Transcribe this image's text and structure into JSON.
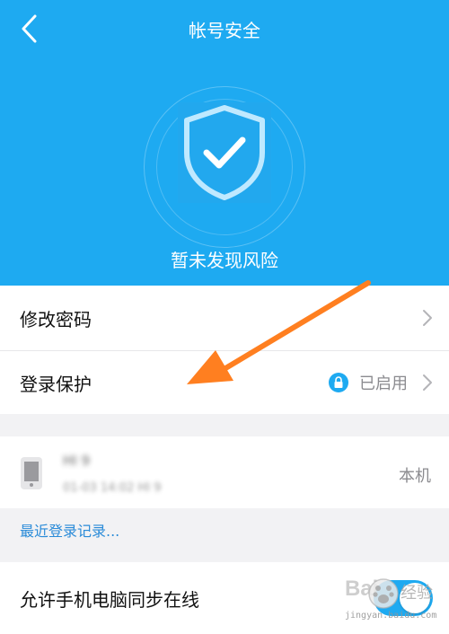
{
  "header": {
    "title": "帐号安全",
    "status_text": "暂未发现风险",
    "back_icon": "chevron-left-icon",
    "shield_icon": "shield-check-icon"
  },
  "menu": {
    "change_password": {
      "label": "修改密码"
    },
    "login_protection": {
      "label": "登录保护",
      "status": "已启用",
      "status_icon": "lock-icon"
    }
  },
  "device": {
    "name": "HI 9",
    "time": "01-03 14:02 HI 9",
    "local_label": "本机",
    "icon": "phone-icon"
  },
  "recent_login": {
    "label": "最近登录记录..."
  },
  "sync": {
    "label": "允许手机电脑同步在线",
    "enabled": true
  },
  "watermark": {
    "brand": "Bai",
    "text": "经验",
    "url": "jingyan.baidu.com"
  },
  "colors": {
    "header_bg": "#1eaaf1",
    "accent": "#1eaaf1",
    "link": "#2a8bd8",
    "arrow": "#ff7f20",
    "page_bg": "#f2f2f4"
  }
}
